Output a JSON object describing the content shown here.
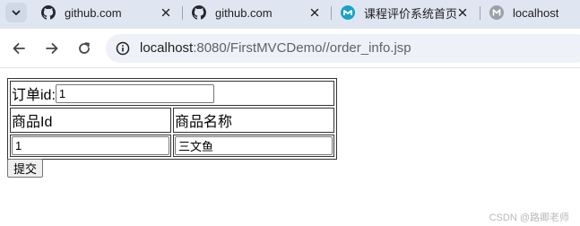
{
  "tabs": [
    {
      "title": "github.com",
      "favicon": "github-icon"
    },
    {
      "title": "github.com",
      "favicon": "github-icon"
    },
    {
      "title": "课程评价系统首页",
      "favicon": "course-site-icon"
    },
    {
      "title": "localhost",
      "favicon": "localhost-globe-icon"
    }
  ],
  "toolbar": {
    "url_host": "localhost",
    "url_path": ":8080/FirstMVCDemo//order_info.jsp"
  },
  "form": {
    "order_id_label": "订单id:",
    "order_id_value": "1",
    "col_product_id": "商品Id",
    "col_product_name": "商品名称",
    "product_id_value": "1",
    "product_name_value": "三文鱼",
    "submit_label": "提交"
  },
  "watermark": "CSDN @路卿老师",
  "colors": {
    "tabstrip": "#dfe6f1",
    "omnibox": "#eef1f7",
    "github_icon": "#24292f",
    "course_icon": "#1aa3c8"
  }
}
